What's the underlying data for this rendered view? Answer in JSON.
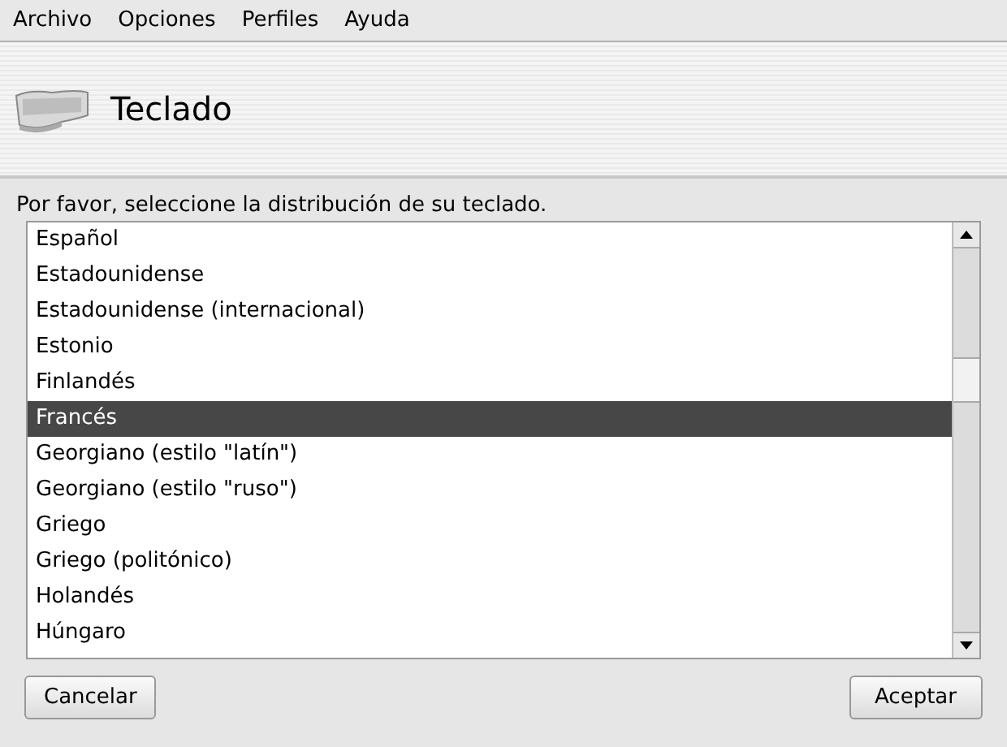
{
  "menu": [
    "Archivo",
    "Opciones",
    "Perfiles",
    "Ayuda"
  ],
  "header": {
    "title": "Teclado"
  },
  "prompt": "Por favor, seleccione la distribución de su teclado.",
  "layouts": [
    {
      "label": "Español",
      "selected": false
    },
    {
      "label": "Estadounidense",
      "selected": false
    },
    {
      "label": "Estadounidense (internacional)",
      "selected": false
    },
    {
      "label": "Estonio",
      "selected": false
    },
    {
      "label": "Finlandés",
      "selected": false
    },
    {
      "label": "Francés",
      "selected": true
    },
    {
      "label": "Georgiano (estilo \"latín\")",
      "selected": false
    },
    {
      "label": "Georgiano (estilo \"ruso\")",
      "selected": false
    },
    {
      "label": "Griego",
      "selected": false
    },
    {
      "label": "Griego (politónico)",
      "selected": false
    },
    {
      "label": "Holandés",
      "selected": false
    },
    {
      "label": "Húngaro",
      "selected": false
    }
  ],
  "buttons": {
    "cancel": "Cancelar",
    "ok": "Aceptar"
  }
}
